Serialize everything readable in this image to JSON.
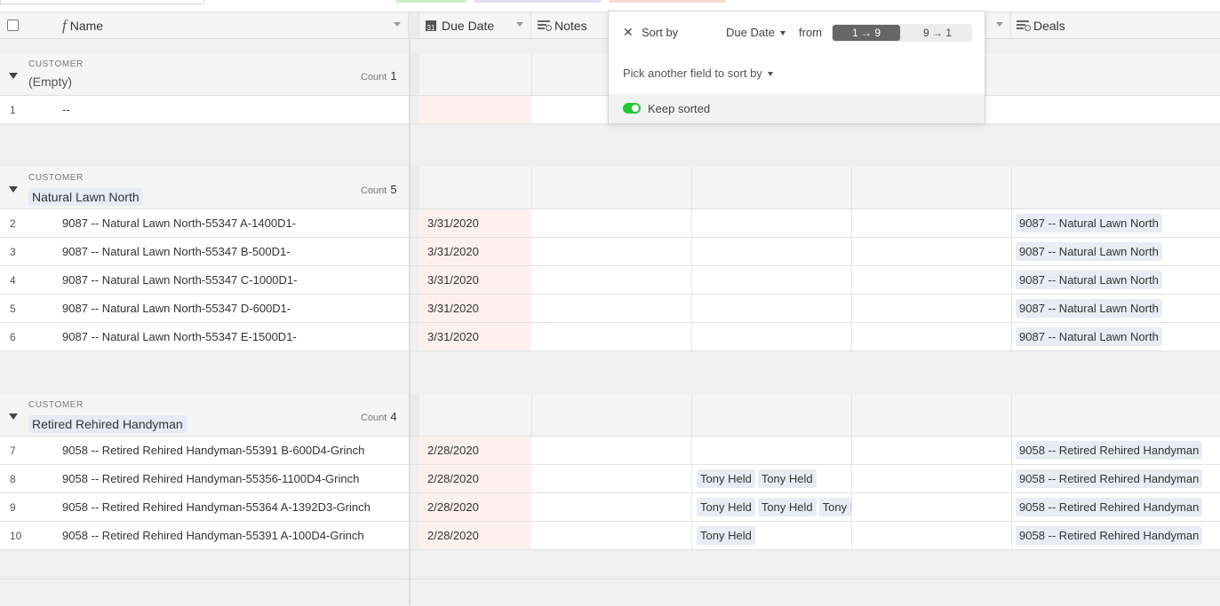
{
  "header": {
    "name_label": "Name",
    "due_label": "Due Date",
    "notes_label": "Notes",
    "deals_label": "Deals"
  },
  "sort_popover": {
    "close_icon": "close-icon",
    "title": "Sort by",
    "field": "Due Date",
    "from_label": "from",
    "asc_label": "1 → 9",
    "desc_label": "9 → 1",
    "pick_label": "Pick another field to sort by",
    "keep_sorted_label": "Keep sorted",
    "keep_sorted_on": true
  },
  "colors": {
    "due_date_cell": "#fdf1ee",
    "toggle_on": "#20c933",
    "chip_bg": "#e9ecf4"
  },
  "groups": [
    {
      "label": "CUSTOMER",
      "value": "(Empty)",
      "count_label": "Count",
      "count": "1",
      "rows": [
        {
          "num": "1",
          "name": "--",
          "due": "",
          "persons": [],
          "deal": ""
        }
      ]
    },
    {
      "label": "CUSTOMER",
      "value": "Natural Lawn North",
      "count_label": "Count",
      "count": "5",
      "rows": [
        {
          "num": "2",
          "name": "9087 -- Natural Lawn North-55347 A-1400D1-",
          "due": "3/31/2020",
          "persons": [],
          "deal": "9087 -- Natural Lawn North"
        },
        {
          "num": "3",
          "name": "9087 -- Natural Lawn North-55347 B-500D1-",
          "due": "3/31/2020",
          "persons": [],
          "deal": "9087 -- Natural Lawn North"
        },
        {
          "num": "4",
          "name": "9087 -- Natural Lawn North-55347 C-1000D1-",
          "due": "3/31/2020",
          "persons": [],
          "deal": "9087 -- Natural Lawn North"
        },
        {
          "num": "5",
          "name": "9087 -- Natural Lawn North-55347 D-600D1-",
          "due": "3/31/2020",
          "persons": [],
          "deal": "9087 -- Natural Lawn North"
        },
        {
          "num": "6",
          "name": "9087 -- Natural Lawn North-55347 E-1500D1-",
          "due": "3/31/2020",
          "persons": [],
          "deal": "9087 -- Natural Lawn North"
        }
      ]
    },
    {
      "label": "CUSTOMER",
      "value": "Retired Rehired Handyman",
      "count_label": "Count",
      "count": "4",
      "rows": [
        {
          "num": "7",
          "name": "9058 -- Retired Rehired Handyman-55391 B-600D4-Grinch",
          "due": "2/28/2020",
          "persons": [],
          "deal": "9058 -- Retired Rehired Handyman"
        },
        {
          "num": "8",
          "name": "9058 -- Retired Rehired Handyman-55356-1100D4-Grinch",
          "due": "2/28/2020",
          "persons": [
            "Tony Held",
            "Tony Held"
          ],
          "deal": "9058 -- Retired Rehired Handyman"
        },
        {
          "num": "9",
          "name": "9058 -- Retired Rehired Handyman-55364 A-1392D3-Grinch",
          "due": "2/28/2020",
          "persons": [
            "Tony Held",
            "Tony Held",
            "Tony Held"
          ],
          "deal": "9058 -- Retired Rehired Handyman"
        },
        {
          "num": "10",
          "name": "9058 -- Retired Rehired Handyman-55391 A-100D4-Grinch",
          "due": "2/28/2020",
          "persons": [
            "Tony Held"
          ],
          "deal": "9058 -- Retired Rehired Handyman"
        }
      ]
    }
  ]
}
